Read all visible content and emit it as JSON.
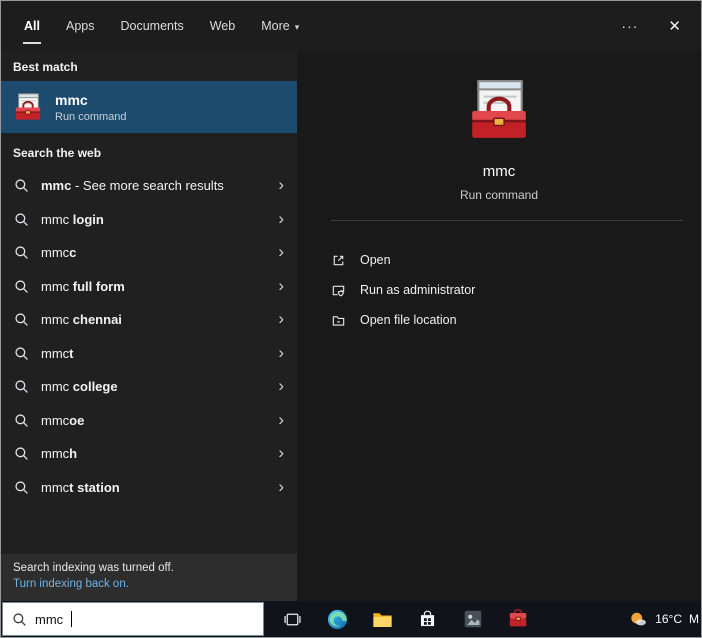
{
  "icons": {
    "chevron_right": "›",
    "dropdown_arrow": "▾",
    "ellipsis": "···",
    "close": "✕"
  },
  "tabs": [
    {
      "label": "All"
    },
    {
      "label": "Apps"
    },
    {
      "label": "Documents"
    },
    {
      "label": "Web"
    },
    {
      "label": "More"
    }
  ],
  "best_match": {
    "header": "Best match",
    "title": "mmc",
    "subtitle": "Run command"
  },
  "web_search": {
    "header": "Search the web",
    "suggestions": [
      {
        "lead": "mmc",
        "tail": " - See more search results"
      },
      {
        "lead": "mmc ",
        "tail": "login"
      },
      {
        "lead": "mmc",
        "tail": "c"
      },
      {
        "lead": "mmc ",
        "tail": "full form"
      },
      {
        "lead": "mmc ",
        "tail": "chennai"
      },
      {
        "lead": "mmc",
        "tail": "t"
      },
      {
        "lead": "mmc ",
        "tail": "college"
      },
      {
        "lead": "mmc",
        "tail": "oe"
      },
      {
        "lead": "mmc",
        "tail": "h"
      },
      {
        "lead": "mmc",
        "tail": "t station"
      }
    ]
  },
  "indexing": {
    "notice": "Search indexing was turned off.",
    "link": "Turn indexing back on."
  },
  "preview": {
    "title": "mmc",
    "subtitle": "Run command",
    "actions": [
      {
        "label": "Open"
      },
      {
        "label": "Run as administrator"
      },
      {
        "label": "Open file location"
      }
    ]
  },
  "search_bar": {
    "value": "mmc"
  },
  "taskbar": {
    "weather_temp": "16°C",
    "weather_partial": "M"
  },
  "colors": {
    "selection": "#1d4b6e",
    "link": "#6fb3e8",
    "taskbar_bg": "#10141a"
  }
}
